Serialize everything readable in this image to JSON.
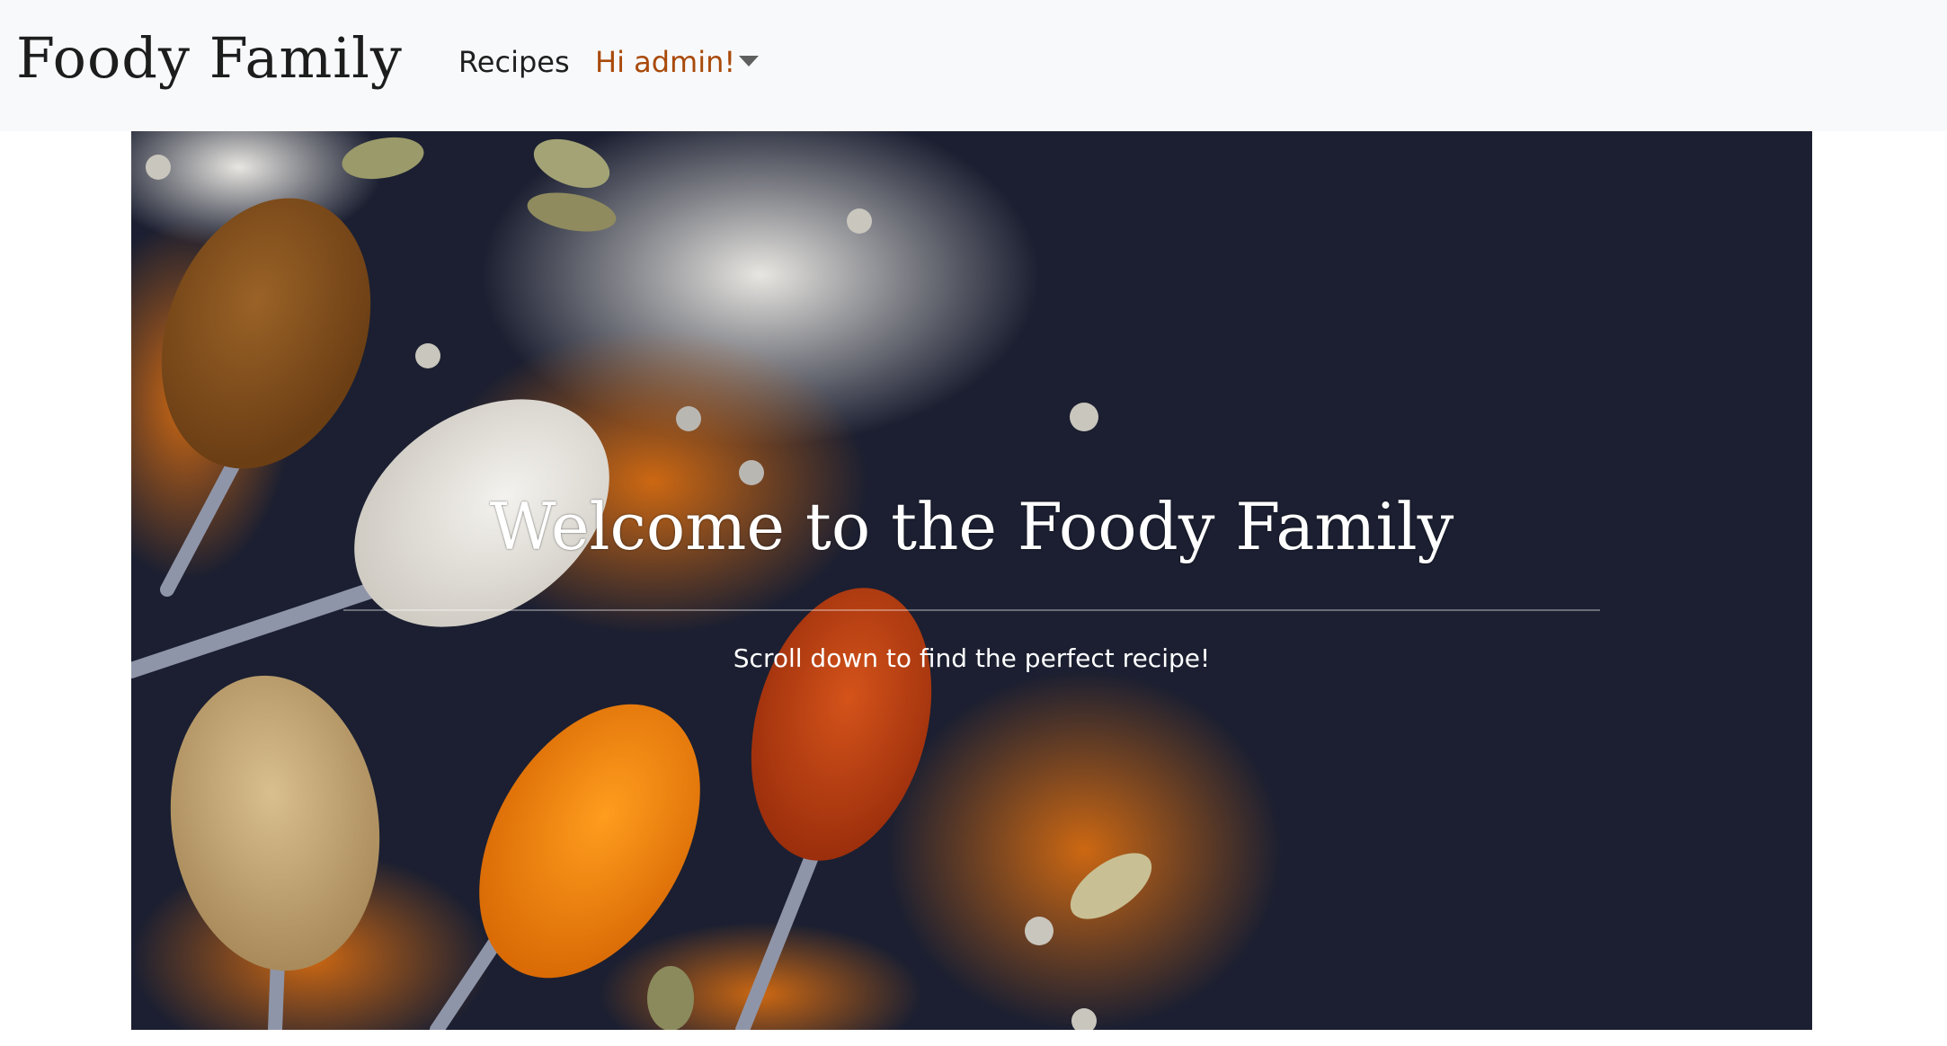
{
  "navbar": {
    "brand": "Foody Family",
    "recipes_label": "Recipes",
    "user_label": "Hi admin!"
  },
  "hero": {
    "title": "Welcome to the Foody Family",
    "subtitle": "Scroll down to find the perfect recipe!"
  },
  "colors": {
    "navbar_bg": "#f8f9fa",
    "user_link": "#a94a0a",
    "hero_bg": "#1a1e2f"
  },
  "icons": {
    "user_menu": "caret-down-icon"
  }
}
